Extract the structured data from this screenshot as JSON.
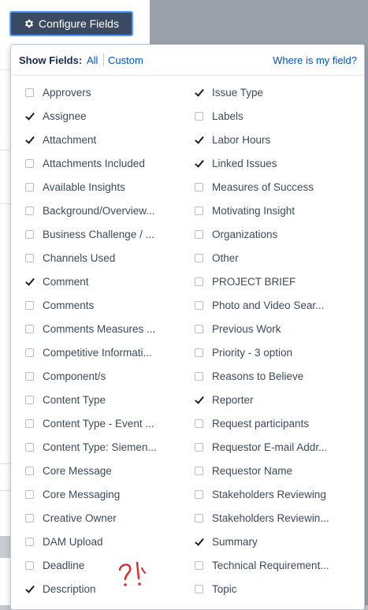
{
  "toolbar": {
    "configure_label": "Configure Fields"
  },
  "panel": {
    "show_fields_label": "Show Fields:",
    "all_label": "All",
    "custom_label": "Custom",
    "where_label": "Where is my field?"
  },
  "fields_left": [
    {
      "label": "Approvers",
      "checked": false
    },
    {
      "label": "Assignee",
      "checked": true
    },
    {
      "label": "Attachment",
      "checked": true
    },
    {
      "label": "Attachments Included",
      "checked": false
    },
    {
      "label": "Available Insights",
      "checked": false
    },
    {
      "label": "Background/Overview...",
      "checked": false
    },
    {
      "label": "Business Challenge / ...",
      "checked": false
    },
    {
      "label": "Channels Used",
      "checked": false
    },
    {
      "label": "Comment",
      "checked": true
    },
    {
      "label": "Comments",
      "checked": false
    },
    {
      "label": "Comments Measures ...",
      "checked": false
    },
    {
      "label": "Competitive Informati...",
      "checked": false
    },
    {
      "label": "Component/s",
      "checked": false
    },
    {
      "label": "Content Type",
      "checked": false
    },
    {
      "label": "Content Type - Event ...",
      "checked": false
    },
    {
      "label": "Content Type: Siemen...",
      "checked": false
    },
    {
      "label": "Core Message",
      "checked": false
    },
    {
      "label": "Core Messaging",
      "checked": false
    },
    {
      "label": "Creative Owner",
      "checked": false
    },
    {
      "label": "DAM Upload",
      "checked": false
    },
    {
      "label": "Deadline",
      "checked": false
    },
    {
      "label": "Description",
      "checked": true
    }
  ],
  "fields_right": [
    {
      "label": "Issue Type",
      "checked": true
    },
    {
      "label": "Labels",
      "checked": false
    },
    {
      "label": "Labor Hours",
      "checked": true
    },
    {
      "label": "Linked Issues",
      "checked": true
    },
    {
      "label": "Measures of Success",
      "checked": false
    },
    {
      "label": "Motivating Insight",
      "checked": false
    },
    {
      "label": "Organizations",
      "checked": false
    },
    {
      "label": "Other",
      "checked": false
    },
    {
      "label": "PROJECT BRIEF",
      "checked": false
    },
    {
      "label": "Photo and Video Sear...",
      "checked": false
    },
    {
      "label": "Previous Work",
      "checked": false
    },
    {
      "label": "Priority - 3 option",
      "checked": false
    },
    {
      "label": "Reasons to Believe",
      "checked": false
    },
    {
      "label": "Reporter",
      "checked": true
    },
    {
      "label": "Request participants",
      "checked": false
    },
    {
      "label": "Requestor E-mail Addr...",
      "checked": false
    },
    {
      "label": "Requestor Name",
      "checked": false
    },
    {
      "label": "Stakeholders Reviewing",
      "checked": false
    },
    {
      "label": "Stakeholders Reviewin...",
      "checked": false
    },
    {
      "label": "Summary",
      "checked": true
    },
    {
      "label": "Technical Requirement...",
      "checked": false
    },
    {
      "label": "Topic",
      "checked": false
    }
  ],
  "icons": {
    "configure": "gear-icon",
    "annotation": "handwritten-question-exclamation",
    "scroll": "chevron-down-icon"
  },
  "colors": {
    "button_bg": "#3a4a63",
    "button_border": "#4c9aff",
    "link": "#0052cc",
    "annotation": "#e0262b",
    "overlay": "#9aa1ab"
  }
}
